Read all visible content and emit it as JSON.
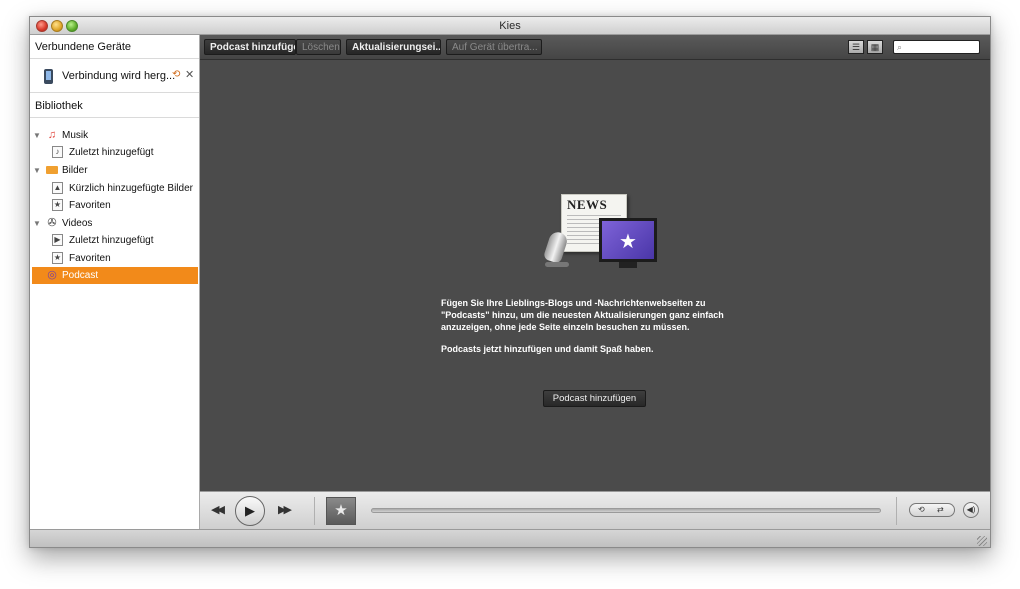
{
  "window": {
    "title": "Kies"
  },
  "sidebar": {
    "connected_header": "Verbundene Geräte",
    "device": {
      "label": "Verbindung wird herg...",
      "icon": "phone-icon",
      "sync_icon": "sync-icon",
      "close_icon": "close-icon"
    },
    "library_header": "Bibliothek",
    "tree": [
      {
        "label": "Musik",
        "icon": "music-note-icon",
        "level": 0,
        "expanded": true
      },
      {
        "label": "Zuletzt hinzugefügt",
        "icon": "music-doc-icon",
        "level": 1
      },
      {
        "label": "Bilder",
        "icon": "photo-folder-icon",
        "level": 0,
        "expanded": true
      },
      {
        "label": "Kürzlich hinzugefügte Bilder",
        "icon": "photo-doc-icon",
        "level": 1
      },
      {
        "label": "Favoriten",
        "icon": "star-doc-icon",
        "level": 1
      },
      {
        "label": "Videos",
        "icon": "film-reel-icon",
        "level": 0,
        "expanded": true
      },
      {
        "label": "Zuletzt hinzugefügt",
        "icon": "video-doc-icon",
        "level": 1
      },
      {
        "label": "Favoriten",
        "icon": "star-doc-icon",
        "level": 1
      },
      {
        "label": "Podcast",
        "icon": "podcast-icon",
        "level": 0,
        "selected": true
      }
    ]
  },
  "toolbar": {
    "add_podcast": "Podcast hinzufügen",
    "delete": "Löschen",
    "update": "Aktualisierungsei...",
    "transfer": "Auf Gerät übertra...",
    "search_placeholder": ""
  },
  "content": {
    "hero_news_text": "NEWS",
    "description": "Fügen Sie Ihre Lieblings-Blogs und -Nachrichtenwebseiten zu \"Podcasts\" hinzu, um die neuesten Aktualisierungen ganz einfach anzuzeigen, ohne jede Seite einzeln besuchen zu müssen.",
    "cta_text": "Podcasts jetzt hinzufügen und damit Spaß haben.",
    "add_button": "Podcast hinzufügen"
  },
  "player": {
    "progress": 0
  },
  "colors": {
    "selection": "#f28a1a",
    "content_bg": "#4b4b4b"
  }
}
